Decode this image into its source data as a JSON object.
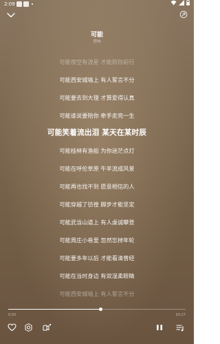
{
  "status_bar": {
    "time": "2:09",
    "icons": [
      "notification-badge-icon",
      "app-badge-icon",
      "dot-icon",
      "wifi-icon",
      "signal-icon",
      "battery-icon"
    ]
  },
  "header": {
    "song_title": "可能",
    "artist": "程响",
    "left_icon": "chevron-down-icon",
    "right_icon": "share-icon"
  },
  "lyrics": {
    "lines": [
      "可能夜空有流星 才能照你前行",
      "可能西安城墙上 有人誓言不分",
      "可能要去到大理 才算爱得认真",
      "可能谁说要陪你 牵手走完一生",
      "可能笑着流出泪 某天在某时辰",
      "可能桂林有渔船 为你迷茫点灯",
      "可能在呼伦草原 牛羊流成风景",
      "可能再也找不到 愿意相信的人",
      "可能穿越了彷徨 脚步才能坚定",
      "可能武当山道上 有人虔诚攀登",
      "可能周庄小巷里 忽然忘掉年轮",
      "可能要多年以后 才能看清曾经",
      "可能在当时身边 有双湿柔眼睛",
      "可能西安城墙上 有人誓言不分"
    ],
    "active_index": 4
  },
  "player": {
    "current_time": "0:50",
    "total_time": "03:27",
    "progress": 0.52,
    "controls": [
      "heart-icon",
      "speed-icon",
      "mv-icon",
      "pause-icon",
      "playlist-icon"
    ]
  }
}
